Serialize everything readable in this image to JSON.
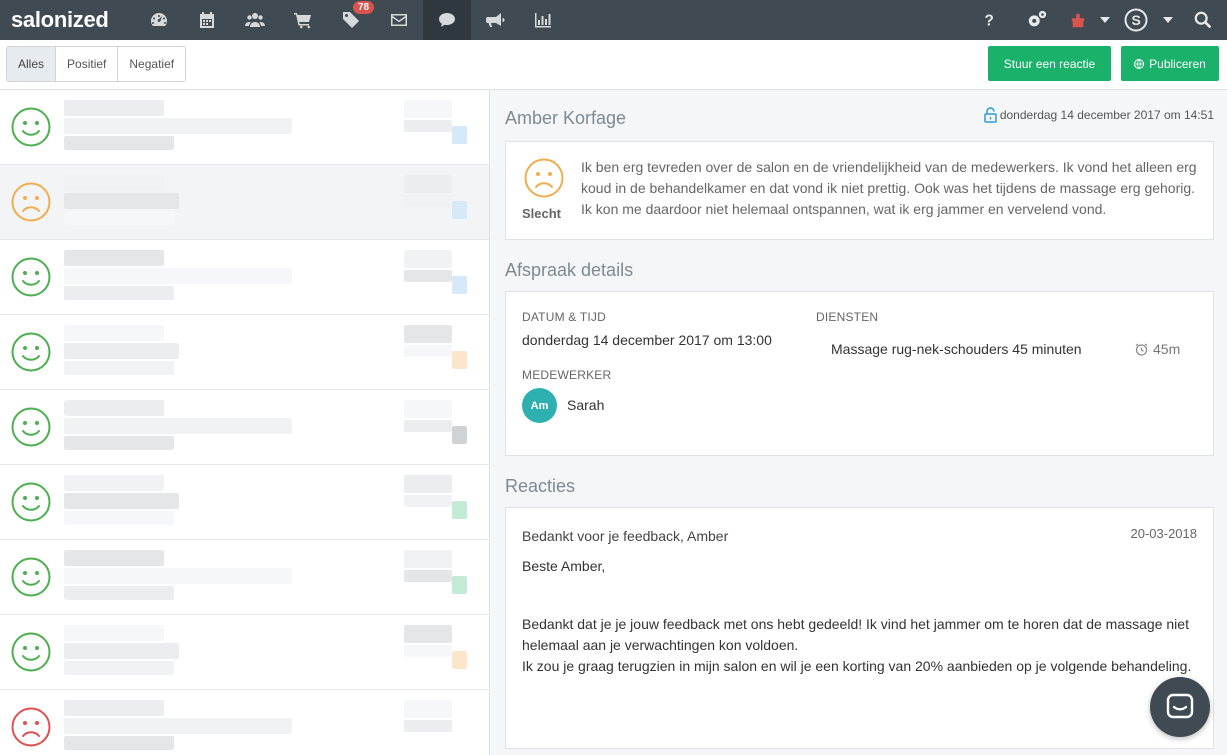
{
  "app": {
    "logo": "salonized",
    "badge_count": "78"
  },
  "nav": {
    "icons": [
      "dashboard-icon",
      "calendar-icon",
      "customers-icon",
      "cart-icon",
      "tag-icon",
      "mail-icon",
      "chat-icon",
      "megaphone-icon",
      "chart-icon"
    ],
    "active": "chat-icon",
    "right_icons": [
      "help-icon",
      "settings-icon",
      "gift-icon",
      "dropdown-icon",
      "account-icon",
      "dropdown-icon",
      "search-icon"
    ]
  },
  "toolbar": {
    "filters": [
      "Alles",
      "Positief",
      "Negatief"
    ],
    "active_filter": "Alles",
    "reply_button": "Stuur een reactie",
    "publish_button": "Publiceren"
  },
  "list": {
    "items": [
      {
        "sentiment": "positive"
      },
      {
        "sentiment": "negative",
        "selected": true
      },
      {
        "sentiment": "positive"
      },
      {
        "sentiment": "positive"
      },
      {
        "sentiment": "positive"
      },
      {
        "sentiment": "positive"
      },
      {
        "sentiment": "positive"
      },
      {
        "sentiment": "positive"
      },
      {
        "sentiment": "very-negative"
      }
    ]
  },
  "review": {
    "customer": "Amber Korfage",
    "date": "donderdag 14 december 2017 om 14:51",
    "rating_label": "Slecht",
    "text": "Ik ben erg tevreden over de salon en de vriendelijkheid van de medewerkers. Ik vond het alleen erg koud in de behandelkamer en dat vond ik niet prettig. Ook was het tijdens de massage erg gehorig. Ik kon me daardoor niet helemaal ontspannen, wat ik erg jammer en vervelend vond."
  },
  "appointment": {
    "section_title": "Afspraak details",
    "datetime_label": "Datum & tijd",
    "datetime_value": "donderdag 14 december 2017 om 13:00",
    "services_label": "Diensten",
    "service_name": "Massage rug-nek-schouders 45 minuten",
    "service_duration": "45m",
    "employee_label": "Medewerker",
    "employee_initials": "Am",
    "employee_name": "Sarah"
  },
  "reactions": {
    "section_title": "Reacties",
    "title": "Bedankt voor je feedback, Amber",
    "date": "20-03-2018",
    "greeting": "Beste Amber,",
    "paragraph1": "Bedankt dat je je jouw feedback met ons hebt gedeeld! Ik vind het jammer om te horen dat de massage niet helemaal aan je verwachtingen kon voldoen.",
    "paragraph2": "Ik zou je graag terugzien in mijn salon en wil je een korting van 20% aanbieden op je volgende behandeling."
  },
  "colors": {
    "positive": "#4caf50",
    "negative": "#f0ad4e",
    "very_negative": "#e05050",
    "accent": "#1ab16a"
  }
}
